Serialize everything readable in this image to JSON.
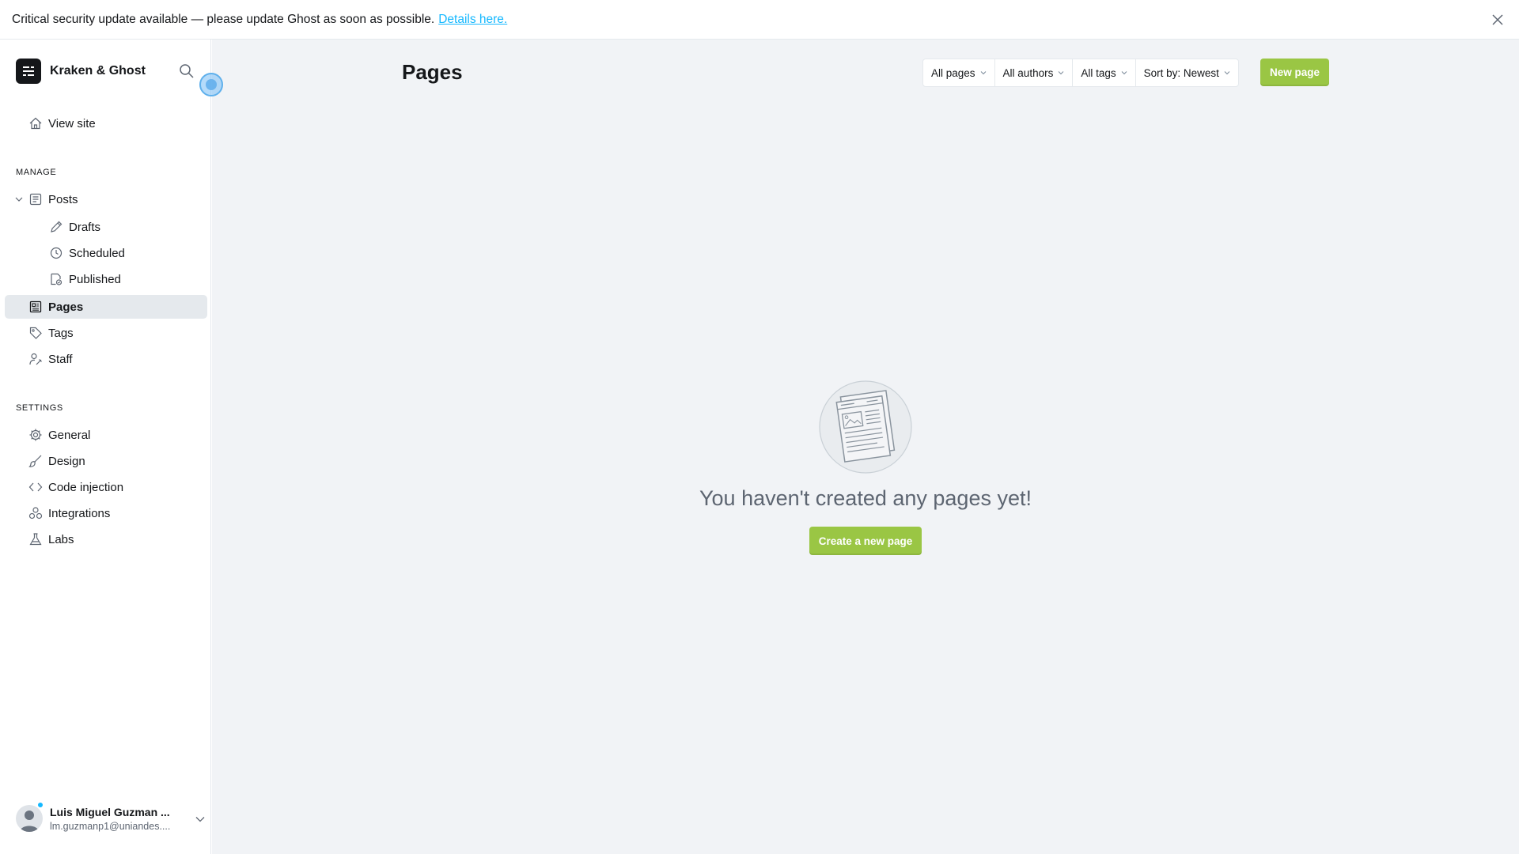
{
  "banner": {
    "message": "Critical security update available — please update Ghost as soon as possible.",
    "link": "Details here."
  },
  "sidebar": {
    "brand": "Kraken & Ghost",
    "view_site": "View site",
    "manage_title": "MANAGE",
    "manage": {
      "posts": "Posts",
      "drafts": "Drafts",
      "scheduled": "Scheduled",
      "published": "Published",
      "pages": "Pages",
      "tags": "Tags",
      "staff": "Staff"
    },
    "settings_title": "SETTINGS",
    "settings": {
      "general": "General",
      "design": "Design",
      "code_injection": "Code injection",
      "integrations": "Integrations",
      "labs": "Labs"
    },
    "user": {
      "name": "Luis Miguel Guzman ...",
      "email": "lm.guzmanp1@uniandes...."
    }
  },
  "main": {
    "title": "Pages",
    "filters": {
      "type": "All pages",
      "authors": "All authors",
      "tags": "All tags",
      "sort": "Sort by: Newest"
    },
    "new_button": "New page",
    "empty_message": "You haven't created any pages yet!",
    "create_button": "Create a new page"
  },
  "colors": {
    "accent_green": "#9ac644",
    "link_blue": "#14b8ff",
    "active_bg": "#e5e9ed",
    "main_bg": "#f1f3f6"
  }
}
